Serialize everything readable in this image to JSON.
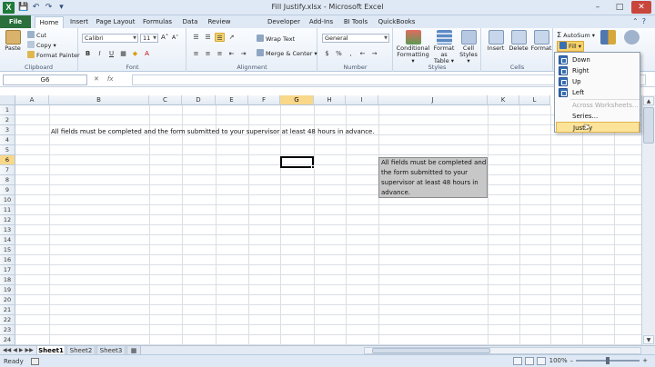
{
  "window": {
    "title": "Fill Justify.xlsx - Microsoft Excel",
    "app_icon": "X",
    "controls": [
      "–",
      "□",
      "✕"
    ]
  },
  "quick_access": [
    "💾",
    "↶",
    "↷",
    "▾"
  ],
  "ribbon_tabs": [
    {
      "label": "File"
    },
    {
      "label": "Home"
    },
    {
      "label": "Insert"
    },
    {
      "label": "Page Layout"
    },
    {
      "label": "Formulas"
    },
    {
      "label": "Data"
    },
    {
      "label": "Review"
    },
    {
      "label": "Developer"
    },
    {
      "label": "Add-Ins"
    },
    {
      "label": "BI Tools"
    },
    {
      "label": "QuickBooks"
    }
  ],
  "clipboard": {
    "paste": "Paste",
    "cut": "Cut",
    "copy": "Copy ▾",
    "format_painter": "Format Painter",
    "label": "Clipboard"
  },
  "font": {
    "name": "Calibri",
    "size": "11",
    "grow": "A˄",
    "shrink": "A˅",
    "bold": "B",
    "italic": "I",
    "underline": "U",
    "label": "Font"
  },
  "alignment": {
    "wrap_text": "Wrap Text",
    "merge_center": "Merge & Center ▾",
    "label": "Alignment"
  },
  "number": {
    "format": "General",
    "currency": "$",
    "percent": "%",
    "comma": ",",
    "label": "Number"
  },
  "styles": {
    "conditional": [
      "Conditional",
      "Formatting ▾"
    ],
    "format_table": [
      "Format",
      "as Table ▾"
    ],
    "cell_styles": [
      "Cell",
      "Styles ▾"
    ],
    "label": "Styles"
  },
  "cells": {
    "insert": "Insert",
    "delete": "Delete",
    "format": "Format",
    "label": "Cells"
  },
  "editing": {
    "autosum": "AutoSum ▾",
    "fill": "Fill ▾"
  },
  "formula_bar": {
    "name_box": "G6",
    "fx": "fx",
    "value": ""
  },
  "columns": [
    "A",
    "B",
    "C",
    "D",
    "E",
    "F",
    "G",
    "H",
    "I",
    "J",
    "K",
    "L"
  ],
  "selected_column": "G",
  "rows": [
    "1",
    "2",
    "3",
    "4",
    "5",
    "6",
    "7",
    "8",
    "9",
    "10",
    "11",
    "12",
    "13",
    "14",
    "15",
    "16",
    "17",
    "18",
    "19",
    "20",
    "21",
    "22",
    "23",
    "24"
  ],
  "selected_row": "6",
  "cells_content": {
    "b3": "All fields must be completed and the form submitted to your supervisor at least 48 hours in advance.",
    "justified": [
      "All fields must be completed and",
      "the form submitted to your",
      "supervisor at least 48 hours in",
      "advance."
    ]
  },
  "sheets": [
    {
      "label": "Sheet1",
      "active": true
    },
    {
      "label": "Sheet2",
      "active": false
    },
    {
      "label": "Sheet3",
      "active": false
    }
  ],
  "status": {
    "ready": "Ready",
    "zoom": "100%",
    "zoom_out": "–",
    "zoom_in": "+"
  },
  "fill_menu": {
    "items": [
      {
        "label": "Down",
        "disabled": false
      },
      {
        "label": "Right",
        "disabled": false
      },
      {
        "label": "Up",
        "disabled": false
      },
      {
        "label": "Left",
        "disabled": false
      },
      {
        "label": "Across Worksheets...",
        "disabled": true
      },
      {
        "label": "Series...",
        "disabled": false
      },
      {
        "label": "Justify",
        "disabled": false,
        "hover": true
      }
    ]
  },
  "colors": {
    "file_tab": "#2a6f3c",
    "ribbon_bg": "#dfe9f5",
    "highlight": "#f6d36c",
    "selected_header": "#f9d88a",
    "justified_fill": "#c7c7c7"
  }
}
